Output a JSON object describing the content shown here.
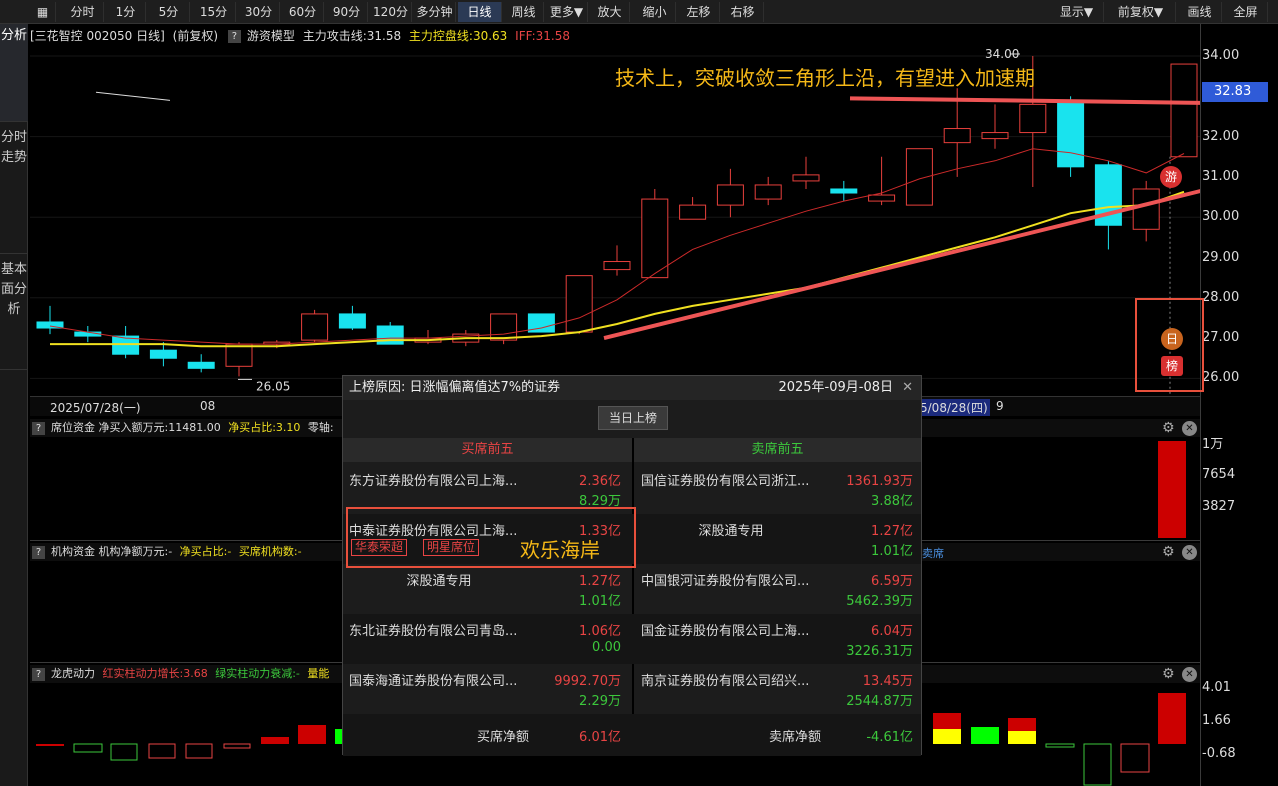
{
  "toolbar": {
    "items": [
      "分时",
      "1分",
      "5分",
      "15分",
      "30分",
      "60分",
      "90分",
      "120分",
      "多分钟",
      "日线",
      "周线",
      "更多▼",
      "放大",
      "缩小",
      "左移",
      "右移"
    ],
    "right": [
      "显示▼",
      "前复权▼",
      "画线",
      "全屏"
    ]
  },
  "side_tabs": [
    "K线分析",
    "分时走势",
    "基本面分析"
  ],
  "info": {
    "stock": "[三花智控 002050 日线]",
    "adj": "(前复权)",
    "model": "游资模型",
    "attack": "主力攻击线:31.58",
    "control": "主力控盘线:30.63",
    "iff": "IFF:31.58"
  },
  "axis": {
    "price": [
      "34.00",
      "32.00",
      "31.00",
      "30.00",
      "29.00",
      "28.00",
      "27.00",
      "26.00"
    ],
    "current": "32.83",
    "panel1": [
      "1万",
      "7654",
      "3827"
    ],
    "panel3": [
      "4.01",
      "1.66",
      "-0.68"
    ]
  },
  "markers": {
    "high": "34.00",
    "low": "26.05",
    "you": "游",
    "ri": "日",
    "bang": "榜"
  },
  "dates": {
    "left": "2025/07/28(一)",
    "mid": "08",
    "right_pre": "5/08/28(四)",
    "right_suf": "9"
  },
  "annotation": {
    "text": "技术上，突破收敛三角形上沿，有望进入加速期",
    "circle_label": "欢乐海岸"
  },
  "panels": {
    "p1": {
      "q": "?",
      "text": "席位资金  净买入额万元:11481.00",
      "ratio": "净买占比:3.10",
      "axis": "零轴:"
    },
    "p2": {
      "q": "?",
      "text": "机构资金  机构净额万元:-",
      "ratio": "净买占比:-",
      "count": "买席机构数:-",
      "extra": "卖席"
    },
    "p3": {
      "q": "?",
      "text": "龙虎动力",
      "red": "红实柱动力增长:3.68",
      "green": "绿实柱动力衰减:-",
      "extra": "量能"
    }
  },
  "popup": {
    "title": "上榜原因: 日涨幅偏离值达7%的证券",
    "date": "2025年-09月-08日",
    "close": "✕",
    "button": "当日上榜",
    "buy_header": "买席前五",
    "sell_header": "卖席前五",
    "buy": [
      {
        "name": "东方证券股份有限公司上海...",
        "buy": "2.36亿",
        "sell": "8.29万"
      },
      {
        "name": "中泰证券股份有限公司上海...",
        "buy": "1.33亿",
        "sell": "",
        "tags": [
          "华泰荣超",
          "明星席位"
        ]
      },
      {
        "name": "深股通专用",
        "buy": "1.27亿",
        "sell": "1.01亿"
      },
      {
        "name": "东北证券股份有限公司青岛...",
        "buy": "1.06亿",
        "sell": "0.00"
      },
      {
        "name": "国泰海通证券股份有限公司...",
        "buy": "9992.70万",
        "sell": "2.29万"
      }
    ],
    "sell": [
      {
        "name": "国信证券股份有限公司浙江...",
        "sell": "1361.93万",
        "buy": "3.88亿"
      },
      {
        "name": "深股通专用",
        "sell": "1.27亿",
        "buy": "1.01亿"
      },
      {
        "name": "中国银河证券股份有限公司...",
        "sell": "6.59万",
        "buy": "5462.39万"
      },
      {
        "name": "国金证券股份有限公司上海...",
        "sell": "6.04万",
        "buy": "3226.31万"
      },
      {
        "name": "南京证券股份有限公司绍兴...",
        "sell": "13.45万",
        "buy": "2544.87万"
      }
    ],
    "buy_net_label": "买席净额",
    "buy_net": "6.01亿",
    "sell_net_label": "卖席净额",
    "sell_net": "-4.61亿"
  },
  "colors": {
    "up": "#e8403c",
    "down": "#19e3ee",
    "ma_yellow": "#f0e020",
    "red_text": "#e84444",
    "green_text": "#3cc83c",
    "anno": "#f5b817"
  },
  "chart_data": {
    "type": "candlestick",
    "x": [
      "2025/07/28",
      "07/29",
      "07/30",
      "07/31",
      "08/01",
      "08/04",
      "08/05",
      "08/06",
      "08/07",
      "08/08",
      "08/11",
      "08/12",
      "08/13",
      "08/14",
      "08/15",
      "08/18",
      "08/19",
      "08/20",
      "08/21",
      "08/22",
      "08/25",
      "08/26",
      "08/27",
      "08/28",
      "08/29",
      "09/01",
      "09/02",
      "09/03",
      "09/04",
      "09/05",
      "09/08"
    ],
    "ohlc": [
      [
        27.4,
        27.8,
        27.1,
        27.25
      ],
      [
        27.15,
        27.3,
        26.9,
        27.05
      ],
      [
        27.05,
        27.3,
        26.5,
        26.6
      ],
      [
        26.7,
        26.9,
        26.3,
        26.5
      ],
      [
        26.4,
        26.6,
        26.15,
        26.25
      ],
      [
        26.3,
        26.9,
        26.05,
        26.85
      ],
      [
        26.9,
        26.95,
        26.75,
        26.9
      ],
      [
        26.95,
        27.7,
        26.9,
        27.6
      ],
      [
        27.6,
        27.8,
        27.2,
        27.25
      ],
      [
        27.3,
        27.4,
        26.85,
        26.85
      ],
      [
        26.9,
        27.2,
        26.85,
        27.0
      ],
      [
        26.9,
        27.2,
        26.8,
        27.1
      ],
      [
        26.95,
        27.6,
        26.85,
        27.6
      ],
      [
        27.6,
        27.6,
        27.15,
        27.15
      ],
      [
        27.15,
        28.3,
        27.1,
        28.55
      ],
      [
        28.7,
        29.3,
        28.55,
        28.9
      ],
      [
        28.5,
        30.7,
        28.5,
        30.45
      ],
      [
        29.95,
        30.5,
        29.95,
        30.3
      ],
      [
        30.3,
        31.2,
        30.0,
        30.8
      ],
      [
        30.45,
        31.0,
        30.3,
        30.8
      ],
      [
        30.9,
        31.5,
        30.7,
        31.05
      ],
      [
        30.7,
        30.9,
        30.4,
        30.6
      ],
      [
        30.4,
        31.5,
        30.3,
        30.55
      ],
      [
        30.3,
        31.7,
        30.3,
        31.7
      ],
      [
        31.85,
        33.2,
        31.0,
        32.2
      ],
      [
        31.95,
        32.8,
        31.7,
        32.1
      ],
      [
        32.1,
        34.0,
        30.75,
        32.8
      ],
      [
        32.9,
        33.0,
        31.0,
        31.25
      ],
      [
        31.3,
        31.4,
        29.2,
        29.8
      ],
      [
        29.7,
        30.9,
        29.4,
        30.7
      ],
      [
        31.5,
        33.8,
        31.5,
        33.8
      ]
    ],
    "ma_red": [
      27.3,
      27.15,
      27.0,
      26.95,
      26.9,
      26.85,
      26.85,
      26.9,
      26.95,
      27.0,
      27.0,
      27.05,
      27.1,
      27.25,
      27.5,
      27.95,
      28.6,
      29.2,
      29.55,
      29.85,
      30.15,
      30.4,
      30.6,
      30.95,
      31.2,
      31.4,
      31.7,
      31.6,
      31.4,
      31.1,
      31.58
    ],
    "ma_yellow": [
      26.85,
      26.85,
      26.85,
      26.85,
      26.8,
      26.8,
      26.8,
      26.85,
      26.9,
      26.95,
      26.95,
      27.0,
      27.0,
      27.05,
      27.15,
      27.35,
      27.6,
      27.8,
      27.95,
      28.1,
      28.25,
      28.5,
      28.75,
      29.0,
      29.25,
      29.5,
      29.8,
      30.1,
      30.25,
      30.3,
      30.63
    ],
    "ylim": [
      25.8,
      34.4
    ]
  }
}
